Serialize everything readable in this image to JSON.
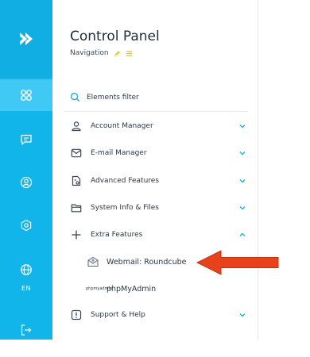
{
  "header": {
    "title": "Control Panel",
    "subtitle": "Navigation"
  },
  "filter": {
    "placeholder": "Elements filter"
  },
  "rail": {
    "language": "EN",
    "items": [
      "dashboard-icon",
      "chat-icon",
      "user-circle-icon",
      "settings-icon",
      "globe-icon",
      "logout-icon"
    ]
  },
  "menu": {
    "account_manager": "Account Manager",
    "email_manager": "E-mail Manager",
    "advanced_features": "Advanced Features",
    "system_info": "System Info & Files",
    "extra_features": "Extra Features",
    "webmail": "Webmail: Roundcube",
    "phpmyadmin": "phpMyAdmin",
    "pma_logo_text": "phpmyadmin",
    "support": "Support & Help"
  },
  "colors": {
    "rail": "#12b5ea",
    "rail_active": "#40c9f4",
    "accent": "#12b5ea",
    "arrow": "#e8421c"
  }
}
